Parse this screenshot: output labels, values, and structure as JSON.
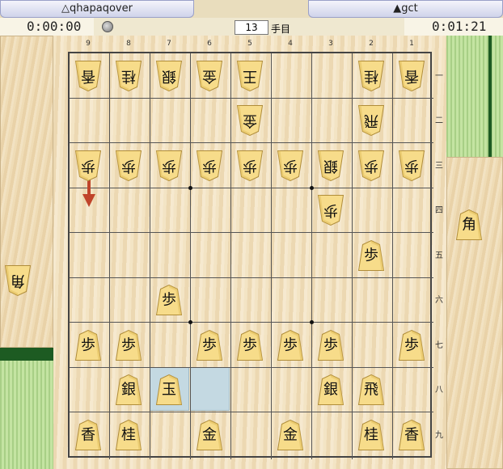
{
  "header": {
    "gote_player": "△qhapaqover",
    "sente_player": "▲gct",
    "gote_clock": "0:00:00",
    "sente_clock": "0:01:21",
    "move_number": "13",
    "move_suffix": "手目"
  },
  "board": {
    "files": [
      "9",
      "8",
      "7",
      "6",
      "5",
      "4",
      "3",
      "2",
      "1"
    ],
    "ranks": [
      "一",
      "二",
      "三",
      "四",
      "五",
      "六",
      "七",
      "八",
      "九"
    ],
    "highlight": [
      {
        "file": 7,
        "rank": 8
      },
      {
        "file": 6,
        "rank": 8
      }
    ],
    "last_move_arrow": {
      "file": 9,
      "from_rank": 3,
      "to_rank": 4
    },
    "pieces": [
      {
        "side": "gote",
        "file": 9,
        "rank": 1,
        "label": "香"
      },
      {
        "side": "gote",
        "file": 8,
        "rank": 1,
        "label": "桂"
      },
      {
        "side": "gote",
        "file": 7,
        "rank": 1,
        "label": "銀"
      },
      {
        "side": "gote",
        "file": 6,
        "rank": 1,
        "label": "金"
      },
      {
        "side": "gote",
        "file": 5,
        "rank": 1,
        "label": "王"
      },
      {
        "side": "gote",
        "file": 2,
        "rank": 1,
        "label": "桂"
      },
      {
        "side": "gote",
        "file": 1,
        "rank": 1,
        "label": "香"
      },
      {
        "side": "gote",
        "file": 5,
        "rank": 2,
        "label": "金"
      },
      {
        "side": "gote",
        "file": 2,
        "rank": 2,
        "label": "飛"
      },
      {
        "side": "gote",
        "file": 9,
        "rank": 3,
        "label": "歩"
      },
      {
        "side": "gote",
        "file": 8,
        "rank": 3,
        "label": "歩"
      },
      {
        "side": "gote",
        "file": 7,
        "rank": 3,
        "label": "歩"
      },
      {
        "side": "gote",
        "file": 6,
        "rank": 3,
        "label": "歩"
      },
      {
        "side": "gote",
        "file": 5,
        "rank": 3,
        "label": "歩"
      },
      {
        "side": "gote",
        "file": 4,
        "rank": 3,
        "label": "歩"
      },
      {
        "side": "gote",
        "file": 3,
        "rank": 3,
        "label": "銀"
      },
      {
        "side": "gote",
        "file": 2,
        "rank": 3,
        "label": "歩"
      },
      {
        "side": "gote",
        "file": 1,
        "rank": 3,
        "label": "歩"
      },
      {
        "side": "gote",
        "file": 3,
        "rank": 4,
        "label": "歩"
      },
      {
        "side": "sente",
        "file": 2,
        "rank": 5,
        "label": "歩"
      },
      {
        "side": "sente",
        "file": 7,
        "rank": 6,
        "label": "歩"
      },
      {
        "side": "sente",
        "file": 9,
        "rank": 7,
        "label": "歩"
      },
      {
        "side": "sente",
        "file": 8,
        "rank": 7,
        "label": "歩"
      },
      {
        "side": "sente",
        "file": 6,
        "rank": 7,
        "label": "歩"
      },
      {
        "side": "sente",
        "file": 5,
        "rank": 7,
        "label": "歩"
      },
      {
        "side": "sente",
        "file": 4,
        "rank": 7,
        "label": "歩"
      },
      {
        "side": "sente",
        "file": 3,
        "rank": 7,
        "label": "歩"
      },
      {
        "side": "sente",
        "file": 1,
        "rank": 7,
        "label": "歩"
      },
      {
        "side": "sente",
        "file": 8,
        "rank": 8,
        "label": "銀"
      },
      {
        "side": "sente",
        "file": 7,
        "rank": 8,
        "label": "玉"
      },
      {
        "side": "sente",
        "file": 3,
        "rank": 8,
        "label": "銀"
      },
      {
        "side": "sente",
        "file": 2,
        "rank": 8,
        "label": "飛"
      },
      {
        "side": "sente",
        "file": 9,
        "rank": 9,
        "label": "香"
      },
      {
        "side": "sente",
        "file": 8,
        "rank": 9,
        "label": "桂"
      },
      {
        "side": "sente",
        "file": 6,
        "rank": 9,
        "label": "金"
      },
      {
        "side": "sente",
        "file": 4,
        "rank": 9,
        "label": "金"
      },
      {
        "side": "sente",
        "file": 2,
        "rank": 9,
        "label": "桂"
      },
      {
        "side": "sente",
        "file": 1,
        "rank": 9,
        "label": "香"
      }
    ]
  },
  "hands": {
    "gote": [
      {
        "label": "角"
      }
    ],
    "sente": [
      {
        "label": "角"
      }
    ]
  },
  "colors": {
    "piece_fill": "#f7dc8a",
    "highlight": "#c4d9e2",
    "arrow": "#c0442a",
    "tatami": "#b9dc97"
  }
}
